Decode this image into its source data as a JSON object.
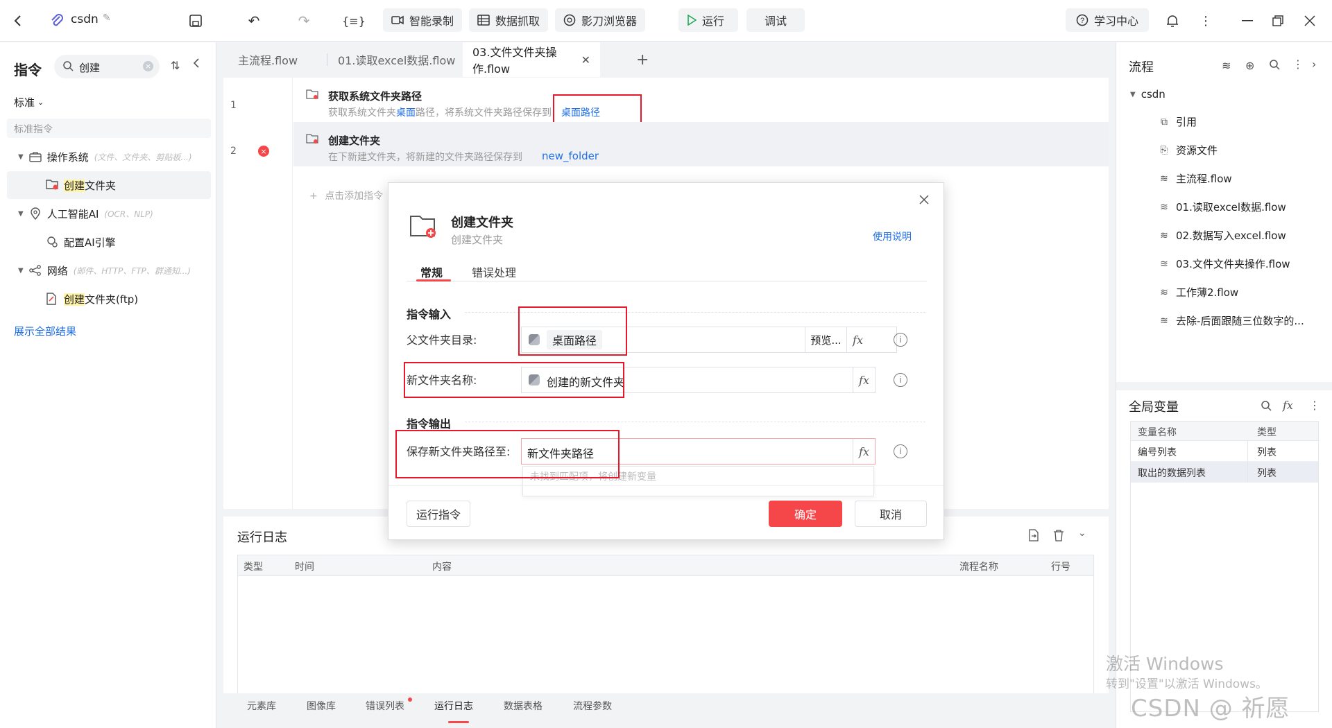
{
  "topbar": {
    "project_name": "csdn",
    "buttons": {
      "smart_record": "智能录制",
      "data_capture": "数据抓取",
      "shadow_browser": "影刀浏览器",
      "run": "运行",
      "debug": "调试",
      "learning_center": "学习中心"
    }
  },
  "left_panel": {
    "title": "指令",
    "search_value": "创建",
    "filter_label": "标准",
    "section_label": "标准指令",
    "tree": [
      {
        "label": "操作系统",
        "hint": "(文件、文件夹、剪贴板...)",
        "children": [
          "创建文件夹"
        ]
      },
      {
        "label": "人工智能AI",
        "hint": "(OCR、NLP)",
        "children": [
          "配置AI引擎"
        ]
      },
      {
        "label": "网络",
        "hint": "(邮件、HTTP、FTP、群通知...)",
        "children": [
          "创建文件夹(ftp)"
        ]
      }
    ],
    "show_all": "展示全部结果"
  },
  "tabs": [
    {
      "label": "主流程.flow",
      "active": false
    },
    {
      "label": "01.读取excel数据.flow",
      "active": false
    },
    {
      "label": "03.文件文件夹操作.flow",
      "active": true
    }
  ],
  "editor": {
    "steps": [
      {
        "num": "1",
        "title": "获取系统文件夹路径",
        "desc_pre": "获取系统文件夹",
        "desc_var1": "桌面",
        "desc_mid": "路径，将系统文件夹路径保存到",
        "desc_var2": "桌面路径"
      },
      {
        "num": "2",
        "title": "创建文件夹",
        "desc_pre": "在下新建文件夹，将新建的文件夹路径保存到",
        "desc_var2": "new_folder"
      }
    ],
    "add_hint": "点击添加指令"
  },
  "log": {
    "title": "运行日志",
    "columns": [
      "类型",
      "时间",
      "内容",
      "流程名称",
      "行号"
    ],
    "bottom_tabs": [
      "元素库",
      "图像库",
      "错误列表",
      "运行日志",
      "数据表格",
      "流程参数"
    ]
  },
  "right_panel": {
    "flow_title": "流程",
    "root": "csdn",
    "items": [
      "引用",
      "资源文件",
      "主流程.flow",
      "01.读取excel数据.flow",
      "02.数据写入excel.flow",
      "03.文件文件夹操作.flow",
      "工作薄2.flow",
      "去除-后面跟随三位数字的..."
    ],
    "globals_title": "全局变量",
    "globals_columns": [
      "变量名称",
      "类型"
    ],
    "globals_rows": [
      {
        "name": "编号列表",
        "type": "列表"
      },
      {
        "name": "取出的数据列表",
        "type": "列表"
      }
    ]
  },
  "dialog": {
    "title": "创建文件夹",
    "subtitle": "创建文件夹",
    "help_link": "使用说明",
    "tabs": [
      "常规",
      "错误处理"
    ],
    "input_section": "指令输入",
    "parent_label": "父文件夹目录:",
    "parent_value": "桌面路径",
    "preview_label": "预览...",
    "name_label": "新文件夹名称:",
    "name_value": "创建的新文件夹",
    "output_section": "指令输出",
    "save_label": "保存新文件夹路径至:",
    "save_value": "新文件夹路径",
    "save_hint": "未找到匹配项，将创建新变量",
    "run_button": "运行指令",
    "ok_button": "确定",
    "cancel_button": "取消"
  },
  "watermark": {
    "activate_title": "激活 Windows",
    "activate_sub": "转到\"设置\"以激活 Windows。",
    "csdn": "CSDN @ 祈愿"
  },
  "colors": {
    "accent_blue": "#1f6fe6",
    "danger_red": "#f5474a",
    "highlight": "#fff4a8",
    "green_run": "#1aaa55"
  }
}
